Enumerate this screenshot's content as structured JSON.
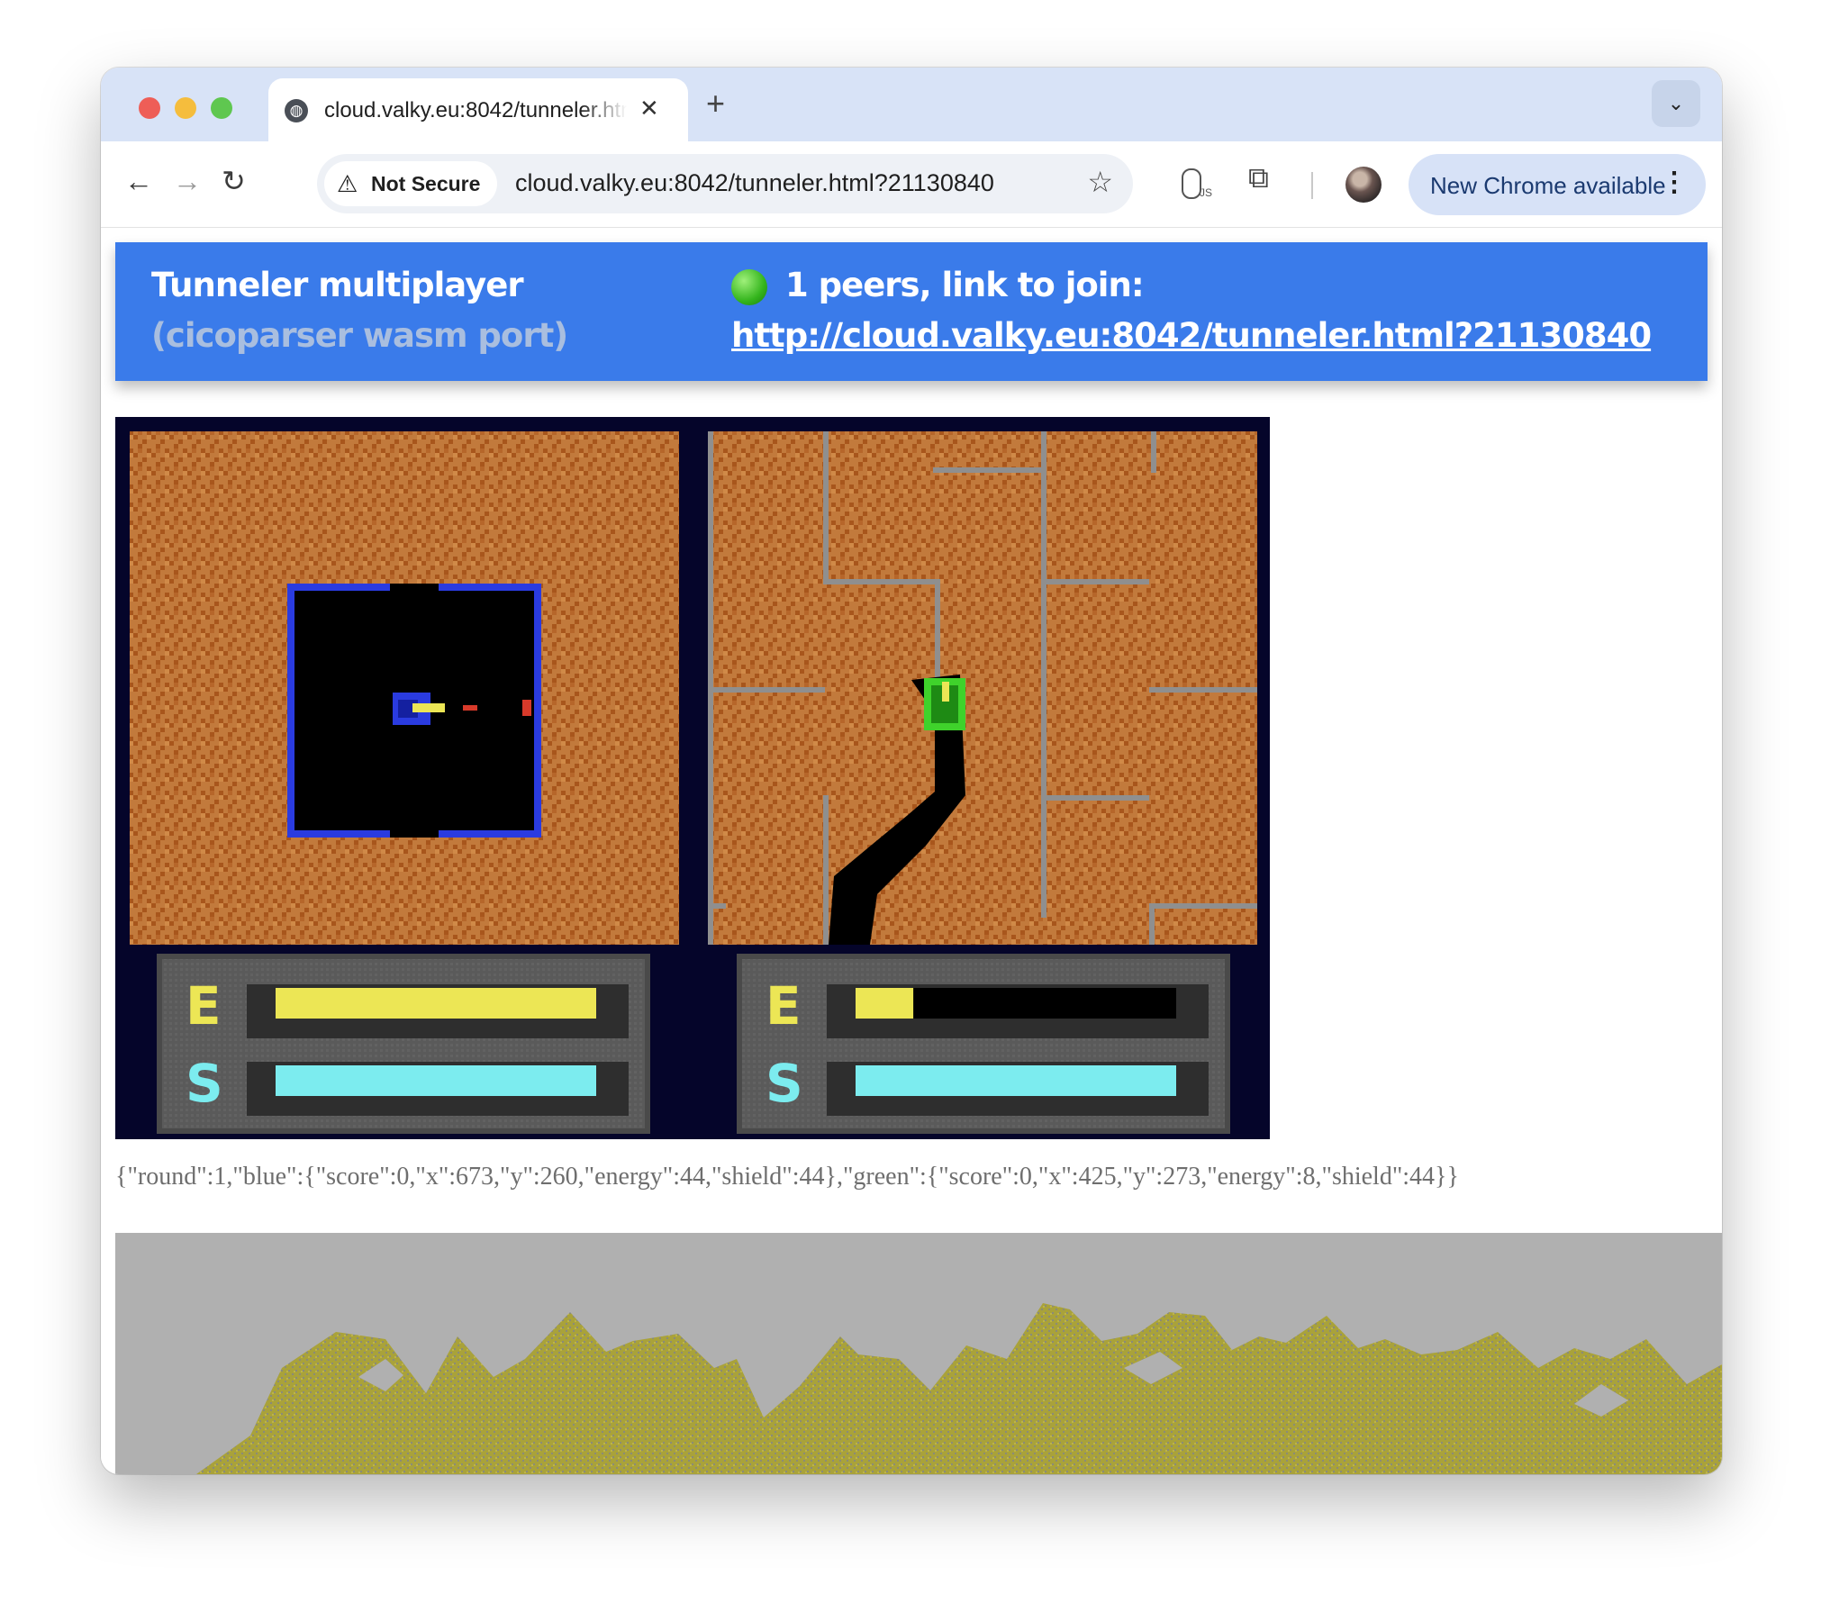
{
  "browser": {
    "tab": {
      "title": "cloud.valky.eu:8042/tunneler.html?21130840",
      "favicon": "globe-icon",
      "close_icon": "close-icon"
    },
    "new_tab_icon": "plus-icon",
    "tab_search_icon": "chevron-down-icon",
    "nav": {
      "back_icon": "arrow-left-icon",
      "forward_icon": "arrow-right-icon",
      "reload_icon": "reload-icon"
    },
    "security_chip": {
      "icon": "warning-icon",
      "label": "Not Secure"
    },
    "url": "cloud.valky.eu:8042/tunneler.html?21130840",
    "bookmark_icon": "star-icon",
    "extensions": [
      "js-toggle-icon",
      "puzzle-icon"
    ],
    "profile_icon": "avatar",
    "update_button": {
      "label": "New Chrome available",
      "menu_icon": "kebab-icon"
    }
  },
  "page": {
    "banner": {
      "title": "Tunneler multiplayer",
      "subtitle": "(cicoparser wasm port)",
      "peers_text": "1 peers, link to join:",
      "status_icon": "green-dot-icon",
      "link": "http://cloud.valky.eu:8042/tunneler.html?21130840"
    },
    "game": {
      "panels": [
        {
          "player": "blue",
          "energy_label": "E",
          "shield_label": "S",
          "energy_fill": 1.0,
          "shield_fill": 1.0
        },
        {
          "player": "green",
          "energy_label": "E",
          "shield_label": "S",
          "energy_fill": 0.18,
          "shield_fill": 1.0
        }
      ]
    },
    "status_json": "{\"round\":1,\"blue\":{\"score\":0,\"x\":673,\"y\":260,\"energy\":44,\"shield\":44},\"green\":{\"score\":0,\"x\":425,\"y\":273,\"energy\":8,\"shield\":44}}"
  },
  "colors": {
    "banner_blue": "#3a7bea",
    "dirt_light": "#c27a3c",
    "dirt_dark": "#a8561c",
    "tank_blue": "#2a3be0",
    "tank_green": "#3fd22b",
    "energy": "#ece655",
    "shield": "#7cecef",
    "terrain_bg": "#b0b0b0",
    "terrain_moss": "#a9a23a"
  }
}
